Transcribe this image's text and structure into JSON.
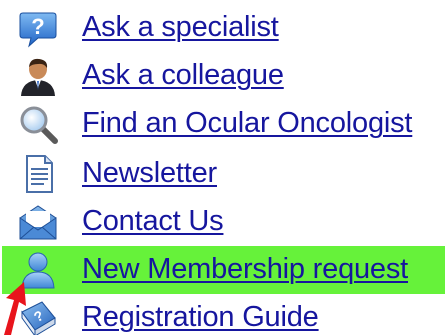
{
  "menu": {
    "items": [
      {
        "label": "Ask a specialist",
        "icon": "help-speech-bubble-icon"
      },
      {
        "label": "Ask a colleague",
        "icon": "person-icon"
      },
      {
        "label": "Find an Ocular Oncologist",
        "icon": "magnifier-icon"
      },
      {
        "label": "Newsletter",
        "icon": "document-icon"
      },
      {
        "label": "Contact Us",
        "icon": "envelope-icon"
      },
      {
        "label": "New Membership request",
        "icon": "user-icon"
      },
      {
        "label": "Registration Guide",
        "icon": "help-book-icon"
      }
    ],
    "highlighted_index": 5
  },
  "colors": {
    "link": "#16169e",
    "highlight": "#66f23a",
    "annotation_arrow": "#e8141c"
  }
}
